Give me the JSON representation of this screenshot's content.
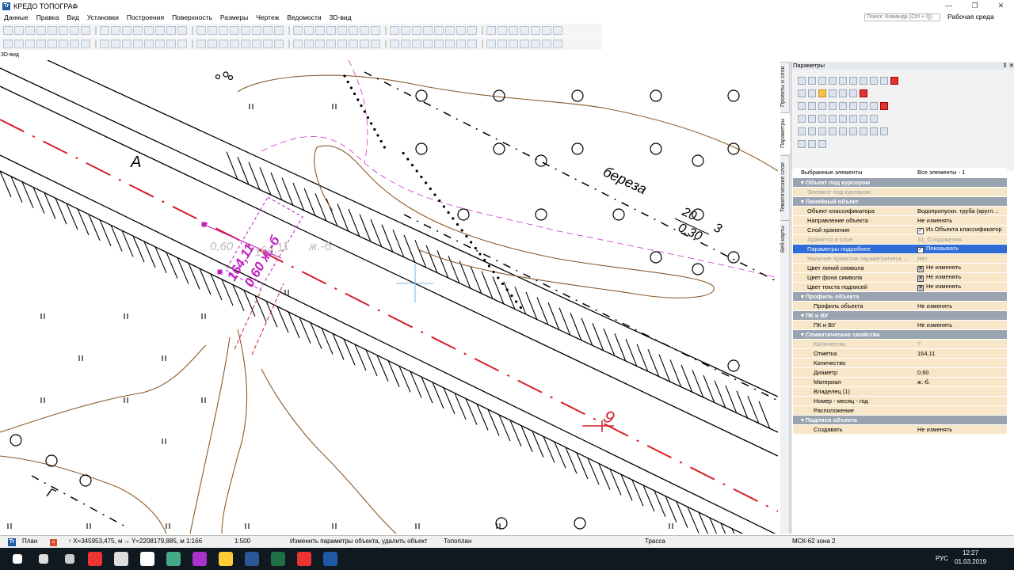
{
  "window": {
    "title": "КРЕДО ТОПОГРАФ",
    "app_icon": "Tr",
    "controls": [
      "—",
      "❐",
      "✕"
    ]
  },
  "menu": [
    "Данные",
    "Правка",
    "Вид",
    "Установки",
    "Построения",
    "Поверхность",
    "Размеры",
    "Чертеж",
    "Ведомости",
    "3D-вид"
  ],
  "search": {
    "placeholder": "Поиск: Команда (Ctrl + Q)"
  },
  "workspace_label": "Рабочая среда",
  "view_label": "3D-вид",
  "map": {
    "label_A": "А",
    "label_bereza": "береза",
    "label_20": "20",
    "label_030": "0,30",
    "label_3": "3",
    "label_9": "9",
    "label_060_gray": "0,60",
    "label_16411_gray": "164,11",
    "label_zhb_gray": "ж.-б.",
    "label_16411_mag": "164,11",
    "label_060_mag": "0,60 ж.-б",
    "label_G": "Г"
  },
  "panel": {
    "title": "Параметры",
    "pin": "⇕ ✕",
    "tabs": [
      "Проекты и слои",
      "Параметры",
      "Тематические слои",
      "Веб-карты"
    ],
    "rows": [
      {
        "type": "top",
        "k": "Выбранные элементы",
        "v": "Все элементы - 1"
      },
      {
        "type": "group",
        "k": "Объект под курсором"
      },
      {
        "type": "dim",
        "k": "Элемент под курсором",
        "v": ""
      },
      {
        "type": "group",
        "k": "Линейный объект"
      },
      {
        "type": "row",
        "k": "Объект классификатора",
        "v": "Водопропускн. труба (кругл…"
      },
      {
        "type": "row",
        "k": "Направление объекта",
        "v": "Не изменять"
      },
      {
        "type": "chk",
        "k": "Слой хранения",
        "v": "Из Объекта классификатор"
      },
      {
        "type": "dim",
        "k": "Хранится в слое",
        "v": "31_Сооружения"
      },
      {
        "type": "sel",
        "k": "Параметры подробнее",
        "v": "Показывать"
      },
      {
        "type": "dim",
        "k": "Наличие проектов параметрическ…",
        "v": "Нет"
      },
      {
        "type": "xbox",
        "k": "Цвет линий символа",
        "v": "Не изменять"
      },
      {
        "type": "xbox",
        "k": "Цвет фона символа",
        "v": "Не изменять"
      },
      {
        "type": "xbox",
        "k": "Цвет текста подписей",
        "v": "Не изменять"
      },
      {
        "type": "group",
        "k": "Профиль объекта"
      },
      {
        "type": "sub",
        "k": "Профиль объекта",
        "v": "Не изменять"
      },
      {
        "type": "group",
        "k": "ПК и ВУ"
      },
      {
        "type": "sub",
        "k": "ПК и ВУ",
        "v": "Не изменять"
      },
      {
        "type": "group",
        "k": "Семантические свойства"
      },
      {
        "type": "subdim",
        "k": "Количество",
        "v": "?"
      },
      {
        "type": "sub",
        "k": "Отметка",
        "v": "164,11"
      },
      {
        "type": "sub",
        "k": "Количество",
        "v": ""
      },
      {
        "type": "sub",
        "k": "Диаметр",
        "v": "0,60"
      },
      {
        "type": "sub",
        "k": "Материал",
        "v": "ж.-б."
      },
      {
        "type": "sub",
        "k": "Владелец (1)",
        "v": ""
      },
      {
        "type": "sub",
        "k": "Номер - месяц - год",
        "v": ""
      },
      {
        "type": "sub",
        "k": "Расположение",
        "v": ""
      },
      {
        "type": "group",
        "k": "Подписи объекта"
      },
      {
        "type": "sub",
        "k": "Создавать",
        "v": "Не изменять"
      }
    ]
  },
  "status": {
    "plan_tab": "План",
    "coord_x": "↑ X=345953,475, м",
    "coord_y": "→ Y=2208179,885, м",
    "scale1": "1:166",
    "scale2": "1:500",
    "hint": "Изменить параметры объекта, удалить объект",
    "layer": "Топоплан",
    "trassa": "Трасса",
    "crs": "МСК-62 зона 2"
  },
  "tray": {
    "lang": "РУС",
    "time": "12:27",
    "date": "01.03.2019"
  },
  "colors": {
    "red_axis": "#d51f2a",
    "magenta": "#c020c0",
    "contour": "#8b5a2b",
    "select": "#2f6cd6",
    "prop_bg": "#f8e6c8",
    "group_bg": "#9aa3b0"
  }
}
